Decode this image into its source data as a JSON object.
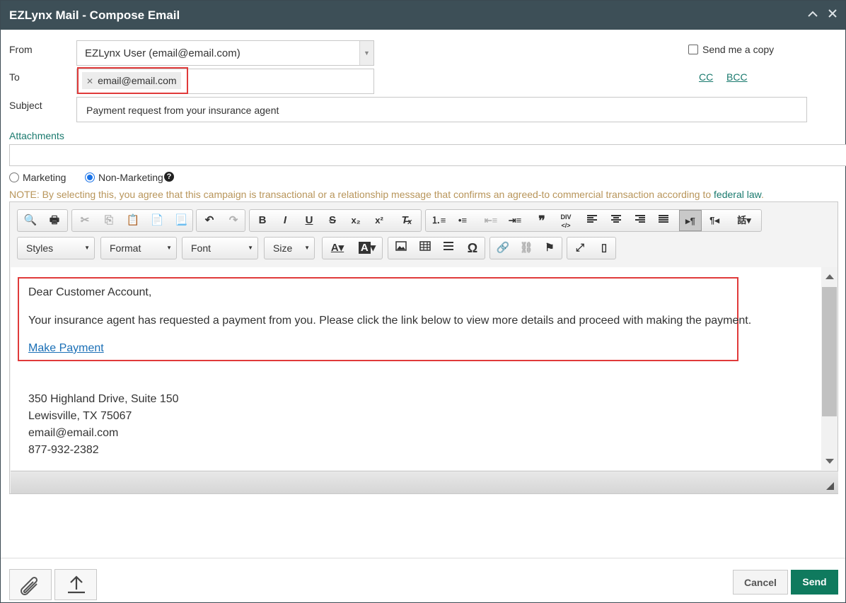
{
  "window": {
    "title": "EZLynx Mail - Compose Email",
    "collapse_icon": "chevron-up-icon",
    "close_icon": "close-icon"
  },
  "form": {
    "from_label": "From",
    "from_value": "EZLynx User (email@email.com)",
    "to_label": "To",
    "to_chip": "email@email.com",
    "subject_label": "Subject",
    "subject_value": "Payment request from your insurance agent",
    "attachments_label": "Attachments",
    "send_copy_label": "Send me a copy",
    "cc_label": "CC",
    "bcc_label": "BCC",
    "radio_marketing": "Marketing",
    "radio_non_marketing": "Non-Marketing",
    "selected_type": "Non-Marketing",
    "note_text": "NOTE: By selecting this, you agree that this campaign is transactional or a relationship message that confirms an agreed-to commercial transaction according to ",
    "note_link": "federal law",
    "note_end": "."
  },
  "toolbar": {
    "styles": "Styles",
    "format": "Format",
    "font": "Font",
    "size": "Size"
  },
  "body": {
    "greeting": "Dear Customer Account,",
    "message": "Your insurance agent has requested a payment from you. Please click the link below to view more details and proceed with making the payment.",
    "link_text": "Make Payment",
    "address1": "350 Highland Drive, Suite 150",
    "address2": "Lewisville, TX 75067",
    "email": "email@email.com",
    "phone": "877-932-2382"
  },
  "footer": {
    "cancel": "Cancel",
    "send": "Send"
  },
  "colors": {
    "titlebar": "#3d4f57",
    "send": "#0f7a5e",
    "link_green": "#1a7a6e",
    "note": "#b8955a",
    "highlight": "#e03a3a"
  }
}
